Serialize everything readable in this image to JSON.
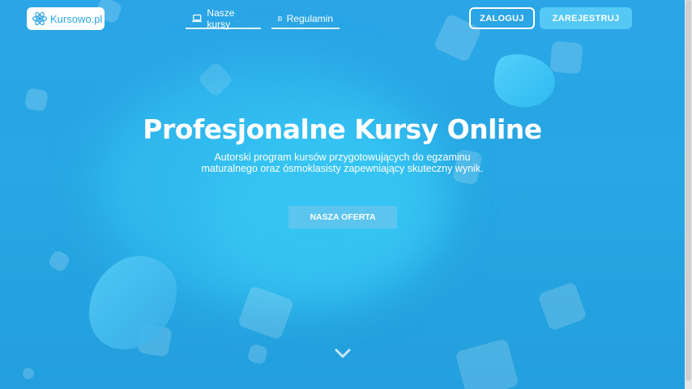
{
  "header": {
    "logo_text": "Kursowo.pl",
    "nav": [
      {
        "label": "Nasze kursy",
        "icon": "laptop-icon"
      },
      {
        "label": "Regulamin",
        "icon": "document-icon"
      }
    ],
    "login_label": "ZALOGUJ",
    "register_label": "ZAREJESTRUJ"
  },
  "hero": {
    "title": "Profesjonalne Kursy Online",
    "subtitle_line1": "Autorski program kursów przygotowujących do egzaminu",
    "subtitle_line2": "maturalnego oraz ósmoklasisty zapewniający skuteczny wynik.",
    "cta_label": "NASZA OFERTA",
    "scroll_icon": "chevron-down-icon"
  },
  "colors": {
    "background": "#2aa5e6",
    "accent": "#55c8f5",
    "text": "#ffffff"
  }
}
